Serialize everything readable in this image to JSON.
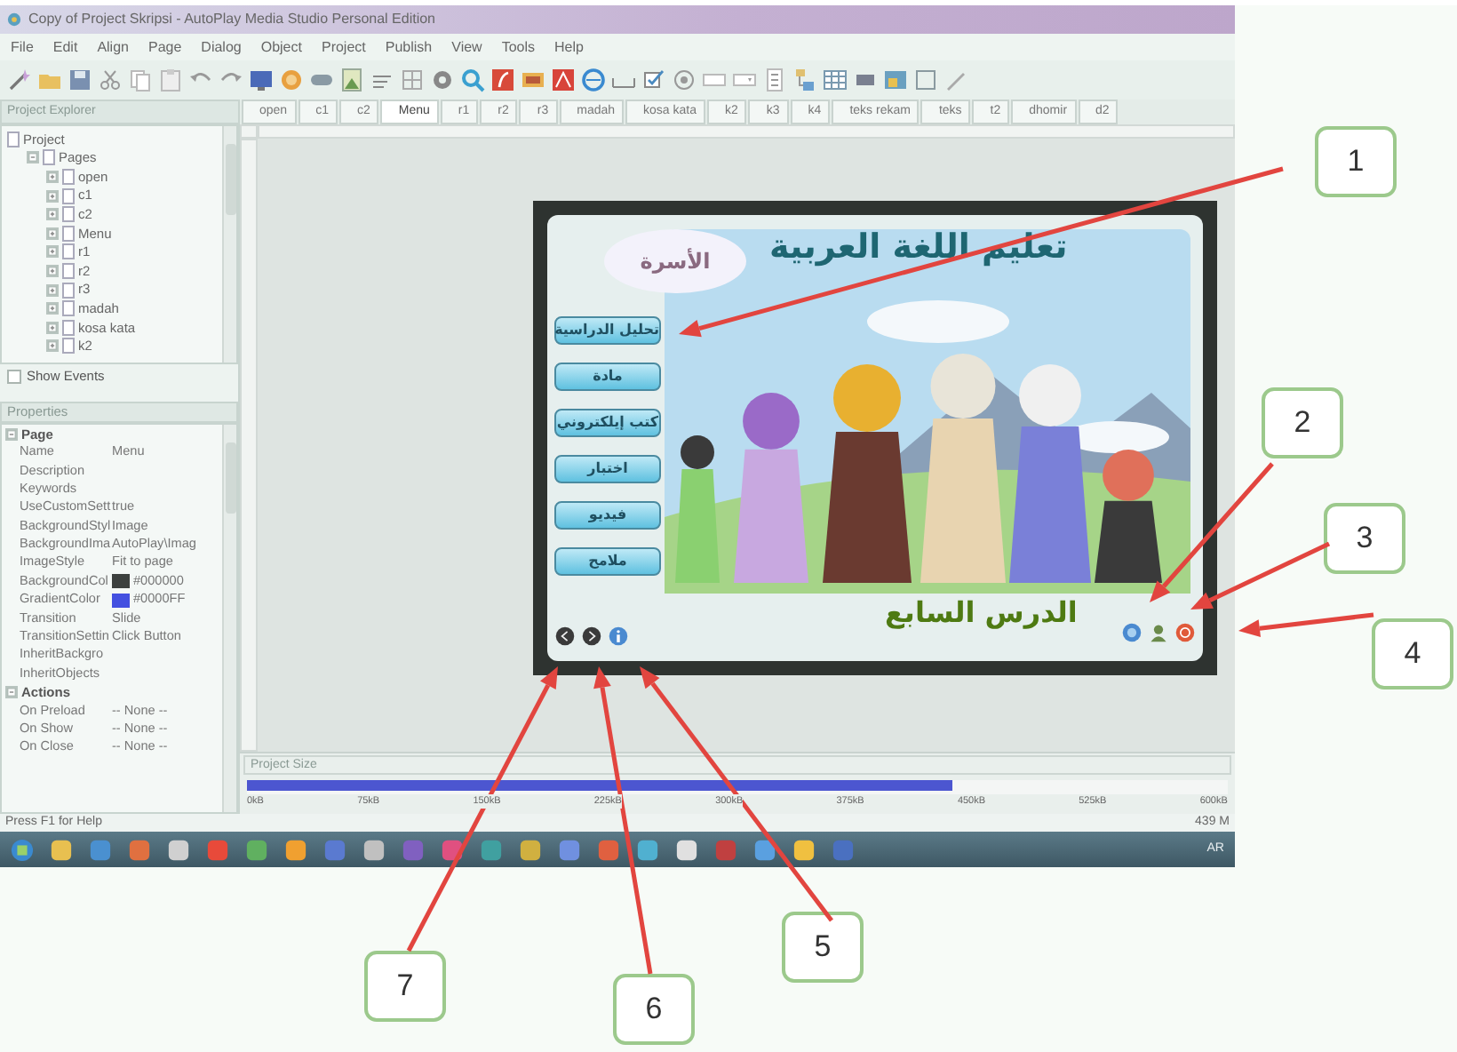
{
  "window": {
    "title": "Copy of Project Skripsi - AutoPlay Media Studio Personal Edition"
  },
  "menu": [
    "File",
    "Edit",
    "Align",
    "Page",
    "Dialog",
    "Object",
    "Project",
    "Publish",
    "View",
    "Tools",
    "Help"
  ],
  "tabs": [
    {
      "label": "open",
      "selected": false
    },
    {
      "label": "c1",
      "selected": false
    },
    {
      "label": "c2",
      "selected": false
    },
    {
      "label": "Menu",
      "selected": true
    },
    {
      "label": "r1",
      "selected": false
    },
    {
      "label": "r2",
      "selected": false
    },
    {
      "label": "r3",
      "selected": false
    },
    {
      "label": "madah",
      "selected": false
    },
    {
      "label": "kosa kata",
      "selected": false
    },
    {
      "label": "k2",
      "selected": false
    },
    {
      "label": "k3",
      "selected": false
    },
    {
      "label": "k4",
      "selected": false
    },
    {
      "label": "teks rekam",
      "selected": false
    },
    {
      "label": "teks",
      "selected": false
    },
    {
      "label": "t2",
      "selected": false
    },
    {
      "label": "dhomir",
      "selected": false
    },
    {
      "label": "d2",
      "selected": false
    }
  ],
  "project_explorer": {
    "title": "Project Explorer",
    "tree": [
      {
        "label": "Project",
        "children": [
          {
            "label": "Pages",
            "expanded": true,
            "children": [
              {
                "label": "open",
                "expanded": false
              },
              {
                "label": "c1",
                "expanded": false
              },
              {
                "label": "c2",
                "expanded": false
              },
              {
                "label": "Menu",
                "expanded": false
              },
              {
                "label": "r1",
                "expanded": false
              },
              {
                "label": "r2",
                "expanded": false
              },
              {
                "label": "r3",
                "expanded": false
              },
              {
                "label": "madah",
                "expanded": false
              },
              {
                "label": "kosa kata",
                "expanded": false
              },
              {
                "label": "k2",
                "expanded": false
              }
            ]
          }
        ]
      }
    ],
    "show_events": {
      "label": "Show Events",
      "checked": false
    }
  },
  "properties": {
    "title": "Properties",
    "groups": [
      {
        "label": "Page",
        "expanded": true,
        "rows": [
          {
            "name": "Name",
            "value": "Menu"
          },
          {
            "name": "Description"
          },
          {
            "name": "Keywords"
          },
          {
            "name": "UseCustomSett",
            "value": "true"
          },
          {
            "name": "BackgroundStyl",
            "value": "Image"
          },
          {
            "name": "BackgroundIma",
            "value": "AutoPlay\\Imag"
          },
          {
            "name": "ImageStyle",
            "value": "Fit to page"
          },
          {
            "name": "BackgroundCol",
            "value": "#000000",
            "color": "#3c403e"
          },
          {
            "name": "GradientColor",
            "value": "#0000FF",
            "color": "#4450e0"
          },
          {
            "name": "Transition",
            "value": "Slide"
          },
          {
            "name": "TransitionSettin",
            "value": "Click Button"
          },
          {
            "name": "InheritBackgro"
          },
          {
            "name": "InheritObjects"
          }
        ]
      },
      {
        "label": "Actions",
        "expanded": true,
        "rows": [
          {
            "name": "On Preload",
            "value": "-- None --"
          },
          {
            "name": "On Show",
            "value": "-- None --"
          },
          {
            "name": "On Close",
            "value": "-- None --"
          }
        ]
      }
    ]
  },
  "page_design": {
    "title": "تعليم اللغة العربية",
    "topic": "الأسرة",
    "menu_buttons": [
      "تحليل الدراسية",
      "مادة",
      "كتب إيلكتروني",
      "اختبار",
      "فيديو",
      "ملامح"
    ],
    "lesson": "الدرس السابع"
  },
  "project_size": {
    "title": "Project Size",
    "level": 0.72,
    "ticks": [
      "0kB",
      "75kB",
      "150kB",
      "225kB",
      "300kB",
      "375kB",
      "450kB",
      "525kB",
      "600kB"
    ]
  },
  "status_bar": {
    "text": "Press F1 for Help",
    "memory": "439 M"
  },
  "taskbar": {
    "language": "AR"
  },
  "callouts": [
    {
      "number": "1"
    },
    {
      "number": "2"
    },
    {
      "number": "3"
    },
    {
      "number": "4"
    },
    {
      "number": "5"
    },
    {
      "number": "6"
    },
    {
      "number": "7"
    }
  ]
}
